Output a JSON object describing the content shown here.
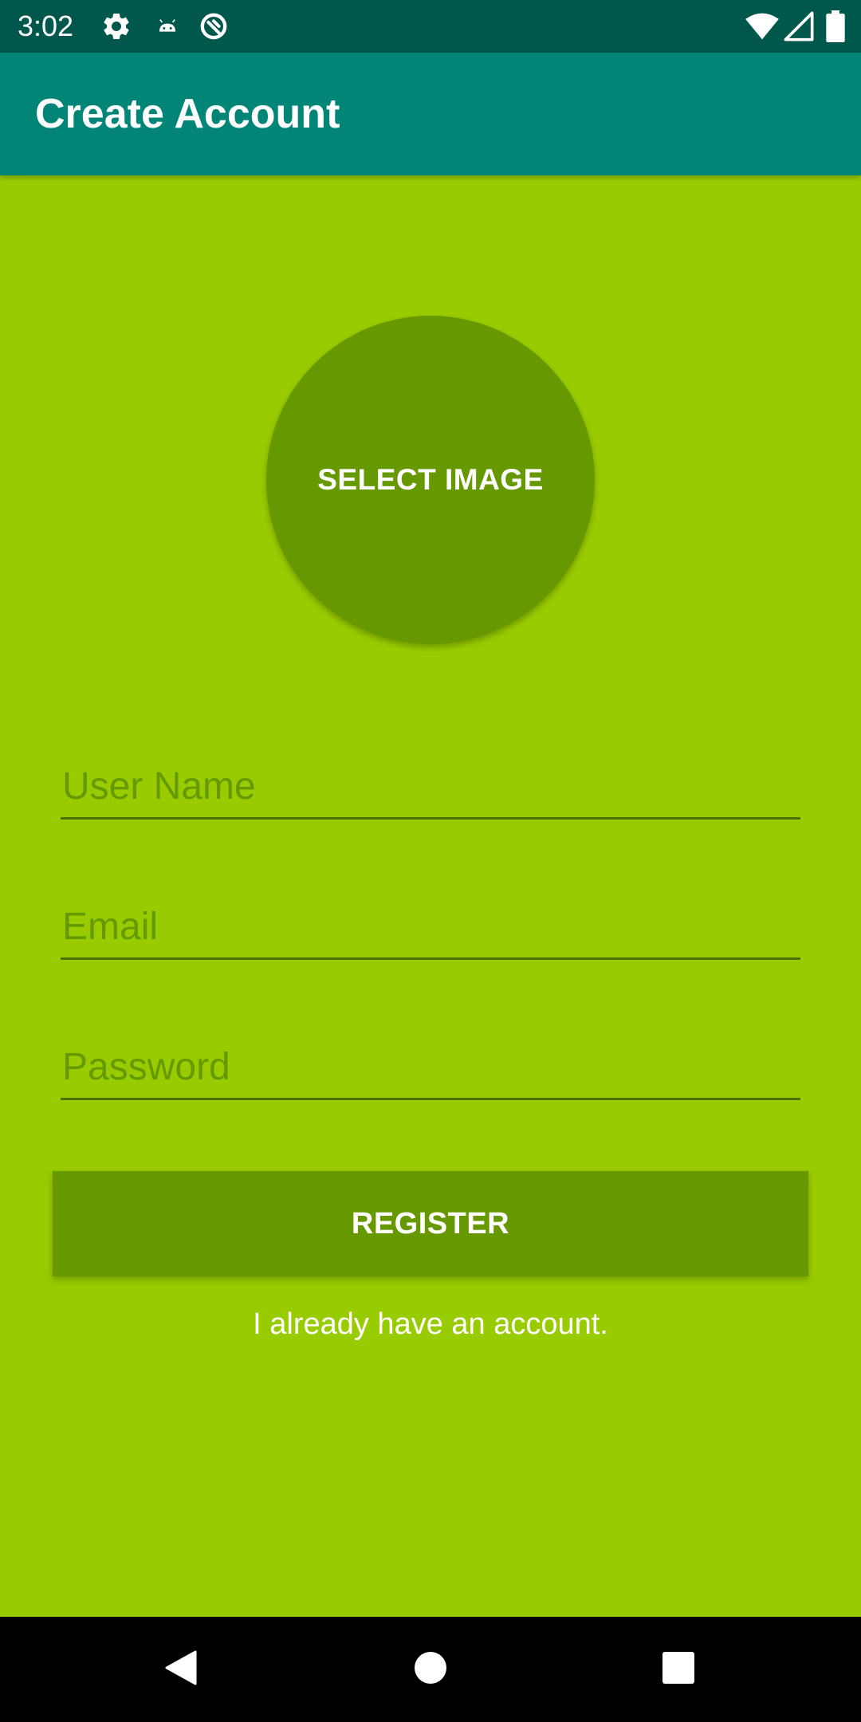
{
  "status_bar": {
    "time": "3:02",
    "icons": [
      "settings-icon",
      "android-icon",
      "sync-icon",
      "wifi-icon",
      "signal-icon",
      "battery-icon"
    ]
  },
  "app_bar": {
    "title": "Create Account"
  },
  "select_image": {
    "label": "SELECT IMAGE"
  },
  "form": {
    "username": {
      "placeholder": "User Name",
      "value": ""
    },
    "email": {
      "placeholder": "Email",
      "value": ""
    },
    "password": {
      "placeholder": "Password",
      "value": ""
    }
  },
  "register_button": {
    "label": "REGISTER"
  },
  "login_link": {
    "text": "I already have an account."
  },
  "nav_bar": {
    "icons": [
      "back-icon",
      "home-icon",
      "recents-icon"
    ]
  },
  "colors": {
    "background": "#99CC00",
    "accent_dark": "#669900",
    "app_bar": "#008577",
    "status_bar": "#00574B"
  }
}
